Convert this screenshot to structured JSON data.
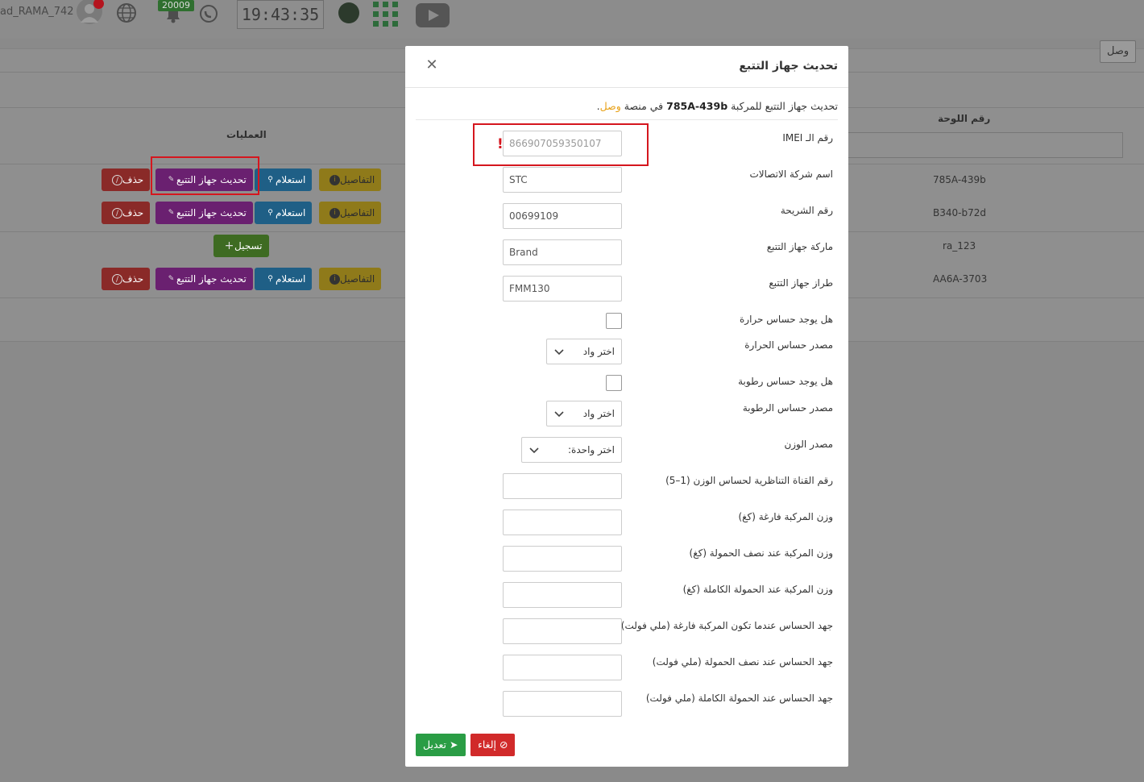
{
  "topbar": {
    "username": "ad_RAMA_742",
    "notification_count": "20009",
    "clock": "19:43:35"
  },
  "page": {
    "panel_button": "وصل",
    "ops_header": "العمليات",
    "plate_header": "رقم اللوحة",
    "rows": [
      {
        "plate": "785A-439b",
        "details": "التفاصيل",
        "query": "استعلام",
        "update": "تحديث جهاز التتبع",
        "delete": "حذف"
      },
      {
        "plate": "B340-b72d",
        "details": "التفاصيل",
        "query": "استعلام",
        "update": "تحديث جهاز التتبع",
        "delete": "حذف"
      },
      {
        "plate": "ra_123",
        "register": "تسجيل"
      },
      {
        "plate": "AA6A-3703",
        "details": "التفاصيل",
        "query": "استعلام",
        "update": "تحديث جهاز التتبع",
        "delete": "حذف"
      }
    ]
  },
  "modal": {
    "title": "تحديث جهاز التتبع",
    "intro_prefix": "تحديث جهاز التتبع للمركبة",
    "intro_vehicle": "785A-439b",
    "intro_mid": "في منصة",
    "intro_brand": "وصل",
    "intro_end": ".",
    "fields": {
      "imei": {
        "label": "رقم الـ IMEI",
        "value": "866907059350107"
      },
      "telecom": {
        "label": "اسم شركة الاتصالات",
        "value": "STC"
      },
      "sim": {
        "label": "رقم الشريحة",
        "value": "00699109"
      },
      "brand": {
        "label": "ماركة جهاز التتبع",
        "value": "Brand"
      },
      "model": {
        "label": "طراز جهاز التتبع",
        "value": "FMM130"
      },
      "has_temp": {
        "label": "هل يوجد حساس حرارة"
      },
      "temp_source": {
        "label": "مصدر حساس الحرارة",
        "value": "اختر واد"
      },
      "has_humidity": {
        "label": "هل يوجد حساس رطوبة"
      },
      "humidity_source": {
        "label": "مصدر حساس الرطوبة",
        "value": "اختر واد"
      },
      "weight_source": {
        "label": "مصدر الوزن",
        "value": "اختر واحدة:"
      },
      "analog_channel": {
        "label": "رقم القناة التناظرية لحساس الوزن (1–5)",
        "value": ""
      },
      "empty_weight": {
        "label": "وزن المركبة فارغة (كغ)",
        "value": ""
      },
      "half_weight": {
        "label": "وزن المركبة عند نصف الحمولة (كغ)",
        "value": ""
      },
      "full_weight": {
        "label": "وزن المركبة عند الحمولة الكاملة (كغ)",
        "value": ""
      },
      "empty_voltage": {
        "label": "جهد الحساس عندما تكون المركبة فارغة (ملي فولت)",
        "value": ""
      },
      "half_voltage": {
        "label": "جهد الحساس عند نصف الحمولة (ملي فولت)",
        "value": ""
      },
      "full_voltage": {
        "label": "جهد الحساس عند الحمولة الكاملة (ملي فولت)",
        "value": ""
      }
    },
    "save_label": "تعديل",
    "cancel_label": "إلغاء"
  },
  "colors": {
    "accent_brand": "#e8a21a",
    "save": "#2a9d45",
    "cancel": "#d12a2a",
    "highlight": "#d5161e"
  }
}
